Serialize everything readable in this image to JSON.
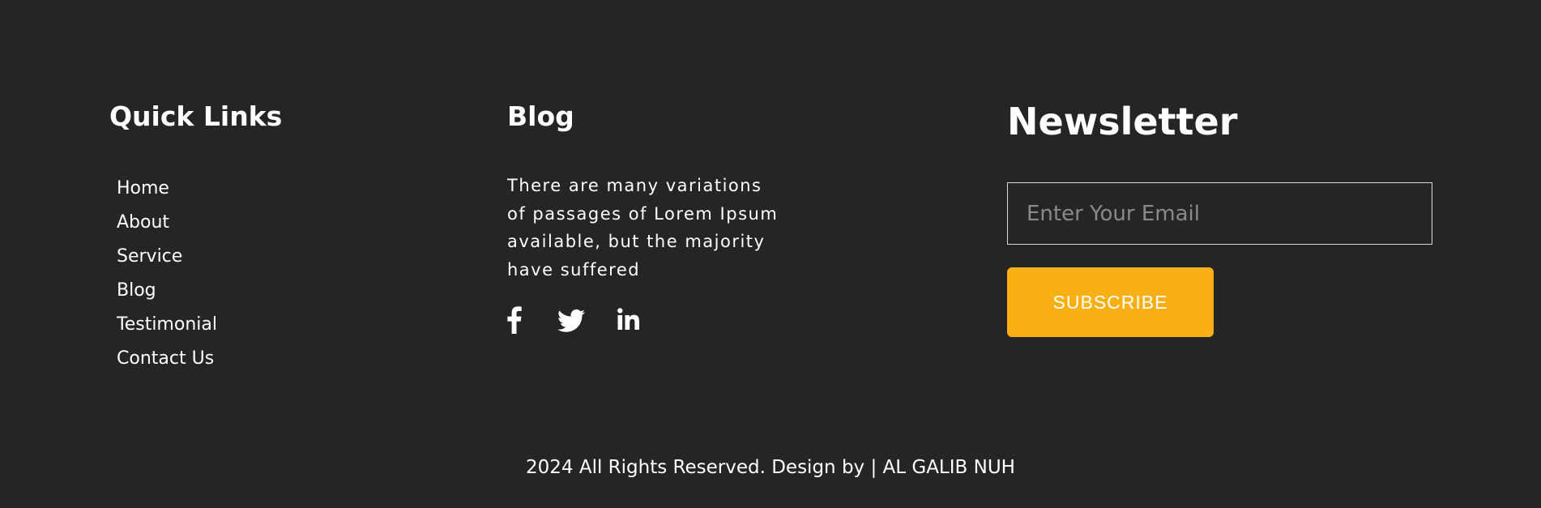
{
  "quick_links": {
    "title": "Quick Links",
    "items": [
      {
        "label": "Home"
      },
      {
        "label": "About"
      },
      {
        "label": "Service"
      },
      {
        "label": "Blog"
      },
      {
        "label": "Testimonial"
      },
      {
        "label": "Contact Us"
      }
    ]
  },
  "blog": {
    "title": "Blog",
    "text": "There are many variations of passages of Lorem Ipsum available, but the majority have suffered",
    "social_icons": [
      "facebook-icon",
      "twitter-icon",
      "linkedin-icon"
    ]
  },
  "newsletter": {
    "title": "Newsletter",
    "email_placeholder": "Enter Your Email",
    "email_value": "",
    "subscribe_label": "SUBSCRIBE"
  },
  "footer": {
    "copyright": "2024 All Rights Reserved. Design by | AL GALIB NUH"
  },
  "colors": {
    "background": "#252525",
    "accent": "#f8b016",
    "text": "#ffffff"
  }
}
